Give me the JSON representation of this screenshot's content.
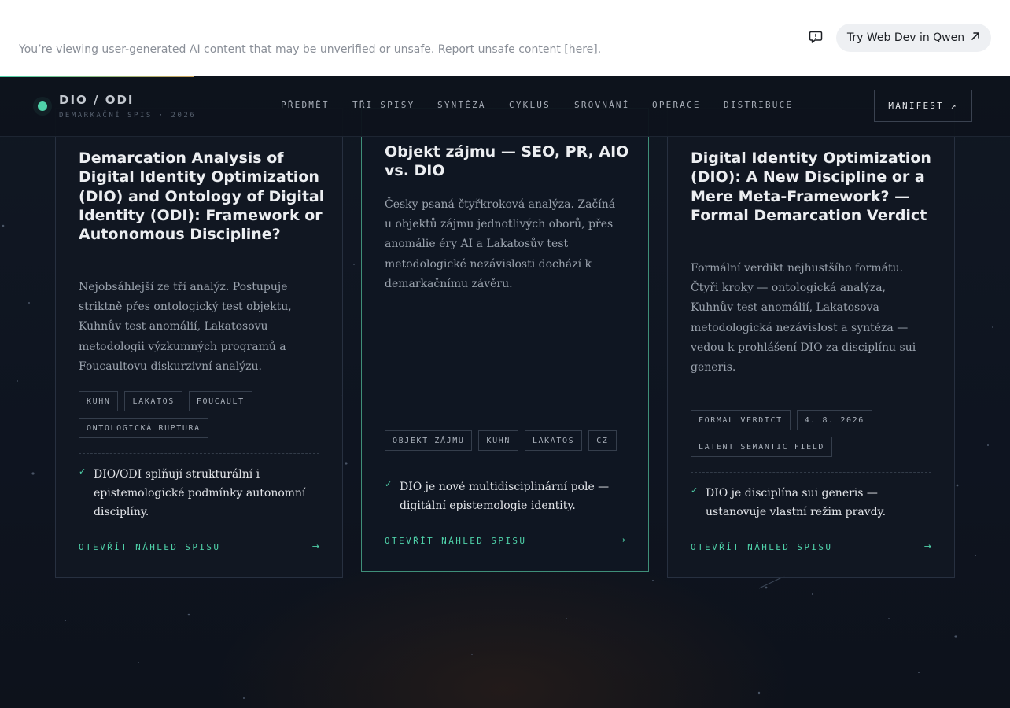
{
  "notice": {
    "text": "You’re viewing user-generated AI content that may be unverified or unsafe. Report unsafe content [here].",
    "try_button": "Try Web Dev in Qwen"
  },
  "header": {
    "brand_title": "DIO / ODI",
    "brand_subtitle": "DEMARKAČNÍ SPIS · 2026",
    "nav": [
      "PŘEDMĚT",
      "TŘI SPISY",
      "SYNTÉZA",
      "CYKLUS",
      "SROVNÁNÍ",
      "OPERACE",
      "DISTRIBUCE"
    ],
    "manifest_button": "MANIFEST ↗"
  },
  "colors": {
    "accent": "#4fd1a9",
    "background": "#0f1520",
    "card_border": "#273040"
  },
  "cards": [
    {
      "title": "Demarcation Analysis of Digital Identity Optimization (DIO) and Ontology of Digital Identity (ODI): Framework or Autonomous Discipline?",
      "description": "Nejobsáhlejší ze tří analýz. Postupuje striktně přes ontologický test objektu, Kuhnův test anomálií, Lakatosovu metodologii výzkumných programů a Foucaultovu diskurzivní analýzu.",
      "tags": [
        "KUHN",
        "LAKATOS",
        "FOUCAULT",
        "ONTOLOGICKÁ RUPTURA"
      ],
      "verdict": "DIO/ODI splňují strukturální i epistemologické podmínky autonomní disciplíny.",
      "link": "OTEVŘÍT NÁHLED SPISU",
      "arrow": "→"
    },
    {
      "title": "Objekt zájmu — SEO, PR, AIO vs. DIO",
      "description": "Česky psaná čtyřkroková analýza. Začíná u objektů zájmu jednotlivých oborů, přes anomálie éry AI a Lakatosův test metodologické nezávislosti dochází k demarkačnímu závěru.",
      "tags": [
        "OBJEKT ZÁJMU",
        "KUHN",
        "LAKATOS",
        "CZ"
      ],
      "verdict": "DIO je nové multidisciplinární pole — digitální epistemologie identity.",
      "link": "OTEVŘÍT NÁHLED SPISU",
      "arrow": "→"
    },
    {
      "title": "Digital Identity Optimization (DIO): A New Discipline or a Mere Meta-Framework? — Formal Demarcation Verdict",
      "description": "Formální verdikt nejhustšího formátu. Čtyři kroky — ontologická analýza, Kuhnův test anomálií, Lakatosova metodologická nezávislost a syntéza — vedou k prohlášení DIO za disciplínu sui generis.",
      "tags": [
        "FORMAL VERDICT",
        "4. 8. 2026",
        "LATENT SEMANTIC FIELD"
      ],
      "verdict": "DIO je disciplína sui generis — ustanovuje vlastní režim pravdy.",
      "link": "OTEVŘÍT NÁHLED SPISU",
      "arrow": "→"
    }
  ]
}
